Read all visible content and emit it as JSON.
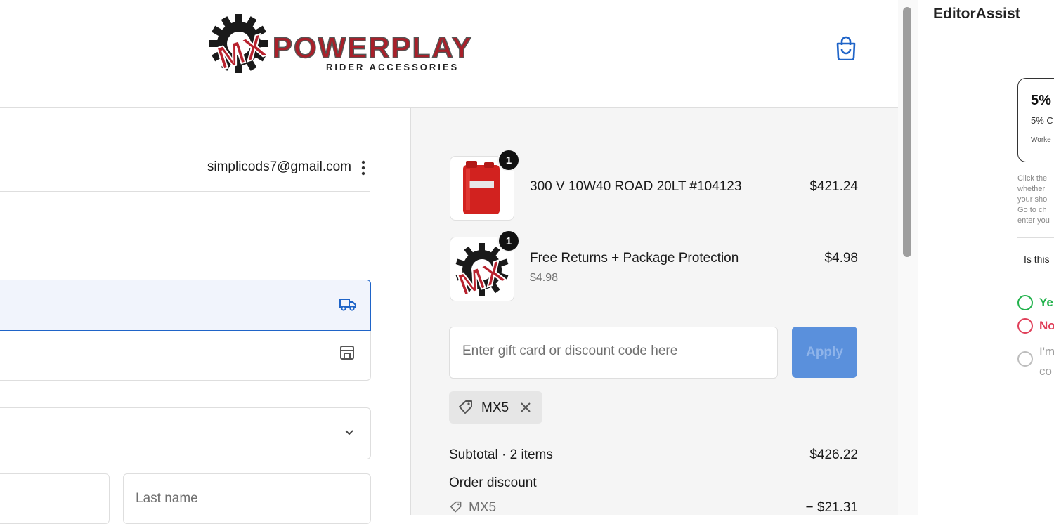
{
  "header": {
    "brand_name": "POWERPLAY",
    "brand_tagline": "RIDER ACCESSORIES",
    "bag_icon": "shopping-bag-icon"
  },
  "account": {
    "email": "simplicods7@gmail.com"
  },
  "delivery": {
    "ship_icon": "truck-icon",
    "pickup_icon": "store-icon"
  },
  "form": {
    "last_name_placeholder": "Last name"
  },
  "cart": {
    "items": [
      {
        "name": "300 V 10W40 ROAD 20LT #104123",
        "price": "$421.24",
        "qty": "1"
      },
      {
        "name": "Free Returns + Package Protection",
        "sub": "$4.98",
        "price": "$4.98",
        "qty": "1"
      }
    ],
    "discount_placeholder": "Enter gift card or discount code here",
    "apply_label": "Apply",
    "applied_code": "MX5",
    "subtotal_label": "Subtotal · 2 items",
    "subtotal_value": "$426.22",
    "order_discount_label": "Order discount",
    "order_discount_code": "MX5",
    "order_discount_value": "− $21.31"
  },
  "panel": {
    "title": "EditorAssist",
    "card_title": "5%",
    "card_sub": "5% C",
    "card_note": "Worke",
    "help_lines": [
      "Click the",
      "whether",
      "your sho",
      "Go to ch",
      "enter you"
    ],
    "question": "Is this",
    "options": [
      "Ye",
      "No",
      "I'm",
      "co"
    ],
    "colors": {
      "yes": "#22b24c",
      "no": "#e0405a",
      "neutral": "#9e9e9e"
    }
  },
  "colors": {
    "accent": "#1f64c8",
    "apply_button": "#5a90dc",
    "brand_red": "#b8232f"
  }
}
